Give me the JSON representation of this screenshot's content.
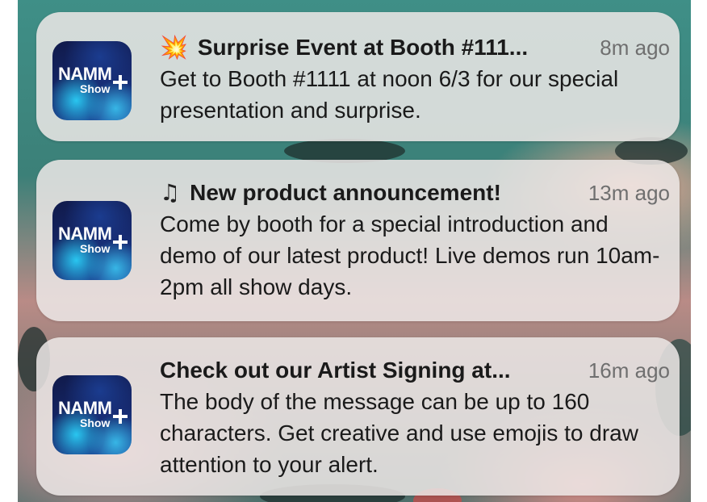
{
  "icon": {
    "brand_word": "NAMM",
    "brand_sub": "Show"
  },
  "notifications": [
    {
      "emoji": "💥",
      "title": "Surprise Event at Booth #111...",
      "time": "8m ago",
      "body": "Get to Booth #1111 at noon 6/3 for our special presentation and surprise."
    },
    {
      "emoji": "♫",
      "title": "New product announcement!",
      "time": "13m ago",
      "body": "Come by booth for a special introduction and demo of our latest product! Live demos run 10am-2pm all show days."
    },
    {
      "emoji": "",
      "title": "Check out our Artist Signing at...",
      "time": "16m ago",
      "body": "The body of the message can be up to 160 characters. Get creative and use emojis to draw attention to your alert."
    }
  ]
}
